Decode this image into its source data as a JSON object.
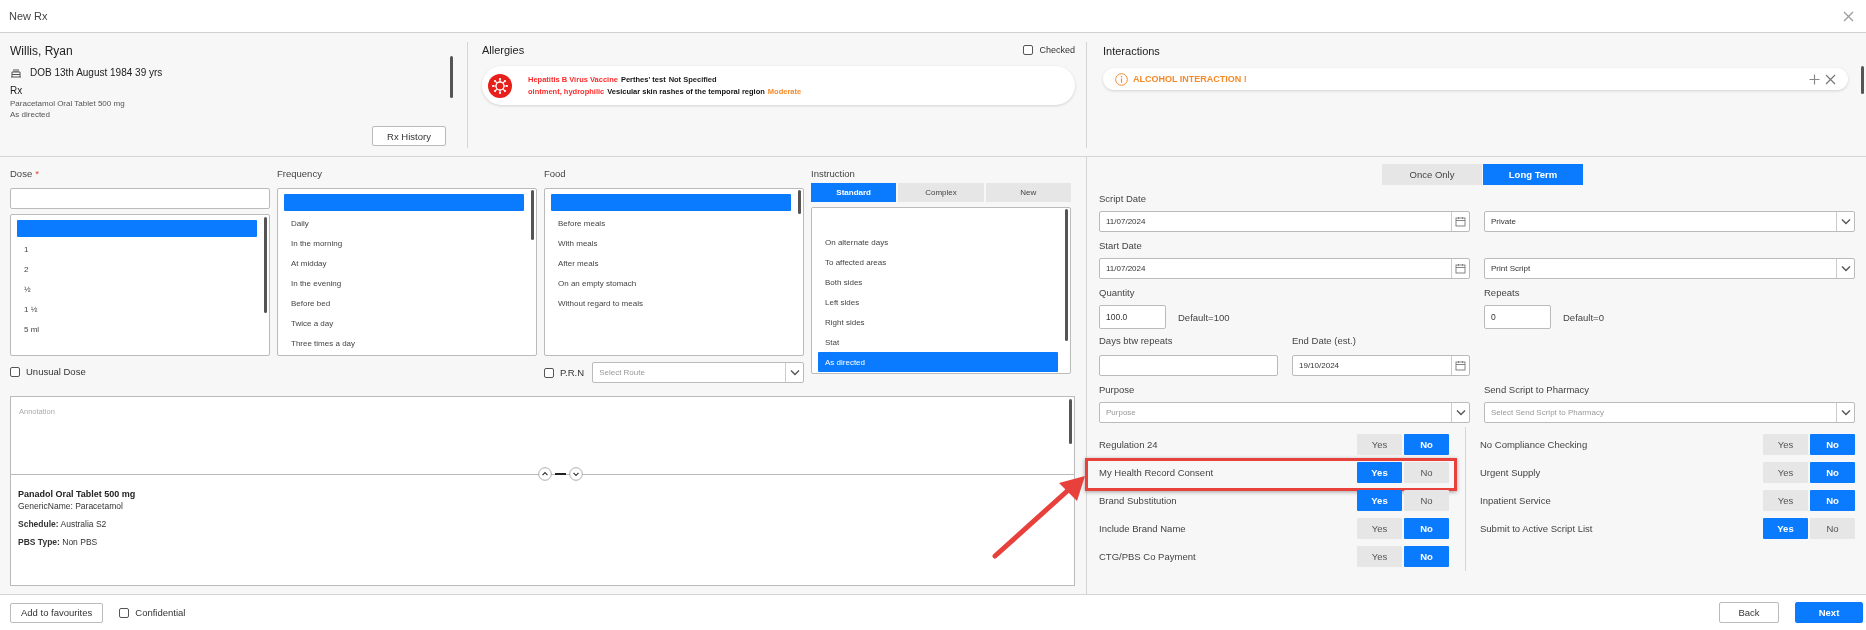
{
  "window": {
    "title": "New Rx"
  },
  "patient": {
    "name": "Willis, Ryan",
    "dob": "DOB 13th August 1984 39 yrs",
    "rx_heading": "Rx",
    "rx_drug": "Paracetamol Oral Tablet 500 mg",
    "rx_directions": "As directed",
    "history_button": "Rx History"
  },
  "allergies": {
    "title": "Allergies",
    "checked_label": "Checked",
    "checked": false,
    "items": [
      {
        "substance": "Hepatitis B Virus Vaccine",
        "reaction": "Perthes' test",
        "severity": "Not Specified",
        "color": "#222222"
      },
      {
        "substance": "ointment, hydrophilic",
        "reaction": "Vesicular skin rashes of the temporal region",
        "severity": "Moderate",
        "color": "#f58a2a"
      }
    ]
  },
  "interactions": {
    "title": "Interactions",
    "items": [
      {
        "text": "ALCOHOL INTERACTION !"
      }
    ]
  },
  "dose": {
    "label": "Dose",
    "required_mark": "*",
    "blank_row_selected": true,
    "items": [
      {
        "label": "1",
        "selected": false
      },
      {
        "label": "2",
        "selected": false
      },
      {
        "label": "½",
        "selected": false
      },
      {
        "label": "1 ½",
        "selected": false
      },
      {
        "label": "5 ml",
        "selected": false
      }
    ],
    "unusual": {
      "label": "Unusual Dose",
      "checked": false
    }
  },
  "frequency": {
    "label": "Frequency",
    "blank_row_selected": true,
    "items": [
      {
        "label": "Daily",
        "selected": false
      },
      {
        "label": "In the morning",
        "selected": false
      },
      {
        "label": "At midday",
        "selected": false
      },
      {
        "label": "In the evening",
        "selected": false
      },
      {
        "label": "Before bed",
        "selected": false
      },
      {
        "label": "Twice a day",
        "selected": false
      },
      {
        "label": "Three times a day",
        "selected": false
      }
    ]
  },
  "food": {
    "label": "Food",
    "blank_row_selected": true,
    "items": [
      {
        "label": "Before meals",
        "selected": false
      },
      {
        "label": "With meals",
        "selected": false
      },
      {
        "label": "After meals",
        "selected": false
      },
      {
        "label": "On an empty stomach",
        "selected": false
      },
      {
        "label": "Without regard to meals",
        "selected": false
      }
    ],
    "prn": {
      "label": "P.R.N",
      "checked": false
    },
    "route": {
      "placeholder": "Select Route"
    }
  },
  "instruction": {
    "label": "Instruction",
    "tabs": [
      {
        "label": "Standard",
        "selected": true
      },
      {
        "label": "Complex",
        "selected": false
      },
      {
        "label": "New",
        "selected": false
      }
    ],
    "blank_row_selected": false,
    "items": [
      {
        "label": "On alternate days",
        "selected": false
      },
      {
        "label": "To affected areas",
        "selected": false
      },
      {
        "label": "Both sides",
        "selected": false
      },
      {
        "label": "Left sides",
        "selected": false
      },
      {
        "label": "Right sides",
        "selected": false
      },
      {
        "label": "Stat",
        "selected": false
      },
      {
        "label": "As directed",
        "selected": true
      }
    ]
  },
  "annotation": {
    "placeholder": "Annotation"
  },
  "drug_info": {
    "name": "Panadol Oral Tablet 500 mg",
    "lines": [
      "GenericName: Paracetamol",
      "**Schedule:** Australia S2",
      "**PBS Type:** Non PBS"
    ]
  },
  "script_type": [
    {
      "label": "Once Only",
      "selected": false
    },
    {
      "label": "Long Term",
      "selected": true
    }
  ],
  "script_date": {
    "label": "Script Date",
    "value": "11/07/2024"
  },
  "payment": {
    "value": "Private"
  },
  "start_date": {
    "label": "Start Date",
    "value": "11/07/2024"
  },
  "script_output": {
    "value": "Print Script"
  },
  "quantity": {
    "label": "Quantity",
    "value": "100.0",
    "default": "Default=100"
  },
  "repeats": {
    "label": "Repeats",
    "value": "0",
    "default": "Default=0"
  },
  "days_between_repeats": {
    "label": "Days btw repeats"
  },
  "end_date": {
    "label": "End Date (est.)",
    "value": "19/10/2024"
  },
  "purpose": {
    "label": "Purpose",
    "placeholder": "Purpose"
  },
  "pharmacy": {
    "label": "Send Script to Pharmacy",
    "placeholder": "Select Send Script to Pharmacy"
  },
  "toggles_left": [
    {
      "label": "Regulation 24",
      "highlighted": false,
      "options": [
        {
          "label": "Yes",
          "selected": false
        },
        {
          "label": "No",
          "selected": true
        }
      ]
    },
    {
      "label": "My Health Record Consent",
      "highlighted": true,
      "options": [
        {
          "label": "Yes",
          "selected": true
        },
        {
          "label": "No",
          "selected": false
        }
      ]
    },
    {
      "label": "Brand Substitution",
      "highlighted": false,
      "options": [
        {
          "label": "Yes",
          "selected": true
        },
        {
          "label": "No",
          "selected": false
        }
      ]
    },
    {
      "label": "Include Brand Name",
      "highlighted": false,
      "options": [
        {
          "label": "Yes",
          "selected": false
        },
        {
          "label": "No",
          "selected": true
        }
      ]
    },
    {
      "label": "CTG/PBS Co Payment",
      "highlighted": false,
      "options": [
        {
          "label": "Yes",
          "selected": false
        },
        {
          "label": "No",
          "selected": true
        }
      ]
    }
  ],
  "toggles_right": [
    {
      "label": "No Compliance Checking",
      "highlighted": false,
      "options": [
        {
          "label": "Yes",
          "selected": false
        },
        {
          "label": "No",
          "selected": true
        }
      ]
    },
    {
      "label": "Urgent Supply",
      "highlighted": false,
      "options": [
        {
          "label": "Yes",
          "selected": false
        },
        {
          "label": "No",
          "selected": true
        }
      ]
    },
    {
      "label": "Inpatient Service",
      "highlighted": false,
      "options": [
        {
          "label": "Yes",
          "selected": false
        },
        {
          "label": "No",
          "selected": true
        }
      ]
    },
    {
      "label": "Submit to Active Script List",
      "highlighted": false,
      "options": [
        {
          "label": "Yes",
          "selected": true
        },
        {
          "label": "No",
          "selected": false
        }
      ]
    }
  ],
  "footer": {
    "favourites_button": "Add to favourites",
    "confidential": {
      "label": "Confidential",
      "checked": false
    },
    "back_button": "Back",
    "next_button": "Next"
  }
}
